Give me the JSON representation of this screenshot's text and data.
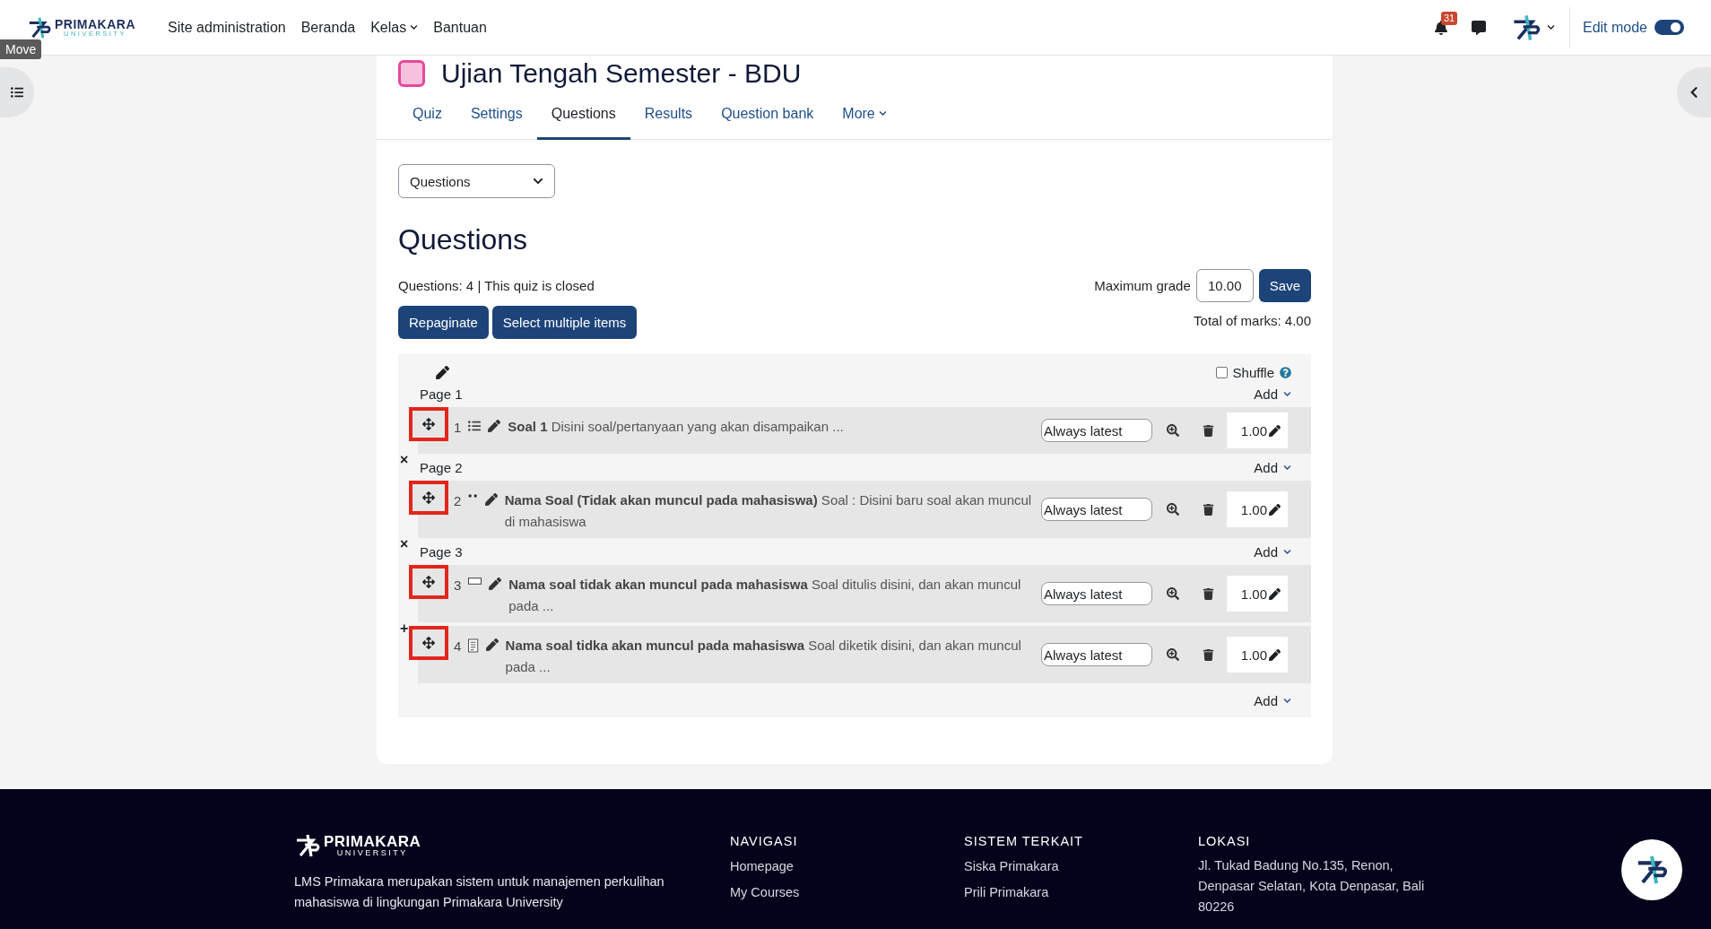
{
  "tooltip": "Move",
  "brand": {
    "name": "PRIMAKARA",
    "subtitle": "UNIVERSITY"
  },
  "nav": [
    {
      "label": "Site administration",
      "dropdown": false
    },
    {
      "label": "Beranda",
      "dropdown": false
    },
    {
      "label": "Kelas",
      "dropdown": true
    },
    {
      "label": "Bantuan",
      "dropdown": false
    }
  ],
  "notifications": {
    "count": "31"
  },
  "edit_mode": {
    "label": "Edit mode",
    "on": true
  },
  "page_title": "Ujian Tengah Semester - BDU",
  "tabs": [
    {
      "label": "Quiz",
      "selected": false,
      "dropdown": false
    },
    {
      "label": "Settings",
      "selected": false,
      "dropdown": false
    },
    {
      "label": "Questions",
      "selected": true,
      "dropdown": false
    },
    {
      "label": "Results",
      "selected": false,
      "dropdown": false
    },
    {
      "label": "Question bank",
      "selected": false,
      "dropdown": false
    },
    {
      "label": "More",
      "selected": false,
      "dropdown": true
    }
  ],
  "view_select": {
    "value": "Questions"
  },
  "heading": "Questions",
  "summary": "Questions: 4 | This quiz is closed",
  "max_grade": {
    "label": "Maximum grade",
    "value": "10.00",
    "button": "Save"
  },
  "actions": [
    "Repaginate",
    "Select multiple items"
  ],
  "total_marks": "Total of marks: 4.00",
  "shuffle": {
    "label": "Shuffle",
    "checked": false
  },
  "pages": [
    {
      "label": "Page 1",
      "add": "Add",
      "questions": [
        {
          "number": "1",
          "kind": "multichoice",
          "text": "**Soal 1** Disini soal/pertanyaan yang akan disampaikan ...",
          "version": "Always latest",
          "mark": "1.00",
          "break_control": "×"
        }
      ]
    },
    {
      "label": "Page 2",
      "add": "Add",
      "questions": [
        {
          "number": "2",
          "kind": "dots",
          "text": "**Nama Soal (Tidak akan muncul pada mahasiswa)** Soal : Disini baru soal akan muncul di mahasiswa",
          "version": "Always latest",
          "mark": "1.00",
          "break_control": "×"
        }
      ]
    },
    {
      "label": "Page 3",
      "add": "Add",
      "questions": [
        {
          "number": "3",
          "kind": "shortanswer",
          "text": "**Nama soal tidak akan muncul pada mahasiswa** Soal ditulis disini, dan akan muncul pada ...",
          "version": "Always latest",
          "mark": "1.00",
          "break_control": "+"
        },
        {
          "number": "4",
          "kind": "essay",
          "text": "**Nama soal tidka akan muncul pada mahasiswa** Soal diketik disini, dan akan muncul pada ...",
          "version": "Always latest",
          "mark": "1.00"
        }
      ]
    }
  ],
  "final_add": "Add",
  "footer": {
    "brand": {
      "name": "PRIMAKARA",
      "subtitle": "UNIVERSITY"
    },
    "description": "LMS Primakara merupakan sistem untuk manajemen perkulihan mahasiswa di lingkungan Primakara University",
    "columns": [
      {
        "heading": "NAVIGASI",
        "links": [
          "Homepage",
          "My Courses"
        ]
      },
      {
        "heading": "SISTEM TERKAIT",
        "links": [
          "Siska Primakara",
          "Prili Primakara"
        ]
      },
      {
        "heading": "LOKASI",
        "text": "Jl. Tukad Badung No.135, Renon, Denpasar Selatan, Kota Denpasar, Bali 80226"
      }
    ]
  }
}
